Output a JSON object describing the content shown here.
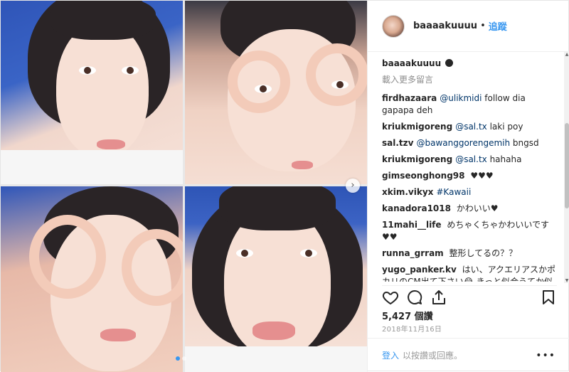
{
  "header": {
    "username": "baaaakuuuu",
    "separator": "•",
    "follow_label": "追蹤"
  },
  "caption": {
    "username": "baaaakuuuu"
  },
  "load_more_label": "載入更多留言",
  "comments": [
    {
      "user": "firdhazaara",
      "mention": "@ulikmidi",
      "text": "follow dia gapapa deh"
    },
    {
      "user": "kriukmigoreng",
      "mention": "@sal.tx",
      "text": "laki poy"
    },
    {
      "user": "sal.tzv",
      "mention": "@bawanggorengemih",
      "text": "bngsd"
    },
    {
      "user": "kriukmigoreng",
      "mention": "@sal.tx",
      "text": "hahaha"
    },
    {
      "user": "gimseonghong98",
      "mention": "",
      "text": "♥♥♥"
    },
    {
      "user": "xkim.vikyx",
      "mention": "#Kawaii",
      "text": ""
    },
    {
      "user": "kanadora1018",
      "mention": "",
      "text": "かわいい♥"
    },
    {
      "user": "11mahi__life",
      "mention": "",
      "text": "めちゃくちゃかわいいです♥♥"
    },
    {
      "user": "runna_grram",
      "mention": "",
      "text": "整形してるの？？"
    },
    {
      "user": "yugo_panker.kv",
      "mention": "",
      "text": "はい、アクエリアスかポカリのCM出て下さい😂 きっと似合うてか似合ってる"
    }
  ],
  "likes_text": "5,427 個讚",
  "date_text": "2018年11月16日",
  "login_bar": {
    "login_label": "登入",
    "suffix_text": "以按讚或回應。",
    "more_label": "•••"
  },
  "icons": {
    "like": "heart-icon",
    "comment": "comment-icon",
    "share": "share-icon",
    "save": "bookmark-icon",
    "next": "chevron-right-icon"
  },
  "colors": {
    "link": "#3897f0",
    "mention": "#003569",
    "muted": "#8e8e8e"
  }
}
